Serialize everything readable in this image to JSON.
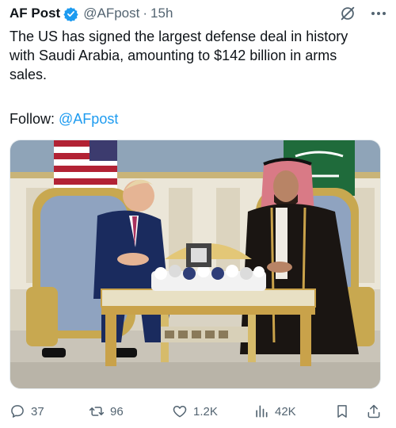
{
  "author": {
    "name": "AF Post",
    "handle": "@AFpost",
    "separator": "·",
    "time": "15h"
  },
  "tweet": {
    "text": "The US has signed the largest defense deal in history\nwith Saudi Arabia, amounting to $142 billion in arms\nsales.",
    "follow_label": "Follow:",
    "follow_handle": "@AFpost"
  },
  "actions": {
    "replies": "37",
    "reposts": "96",
    "likes": "1.2K",
    "views": "42K"
  },
  "colors": {
    "accent": "#1d9bf0",
    "muted": "#536471",
    "verified": "#1d9bf0"
  },
  "icons": [
    "verified-badge-icon",
    "grok-icon",
    "more-icon",
    "reply-icon",
    "repost-icon",
    "like-icon",
    "views-icon",
    "bookmark-icon",
    "share-icon"
  ]
}
